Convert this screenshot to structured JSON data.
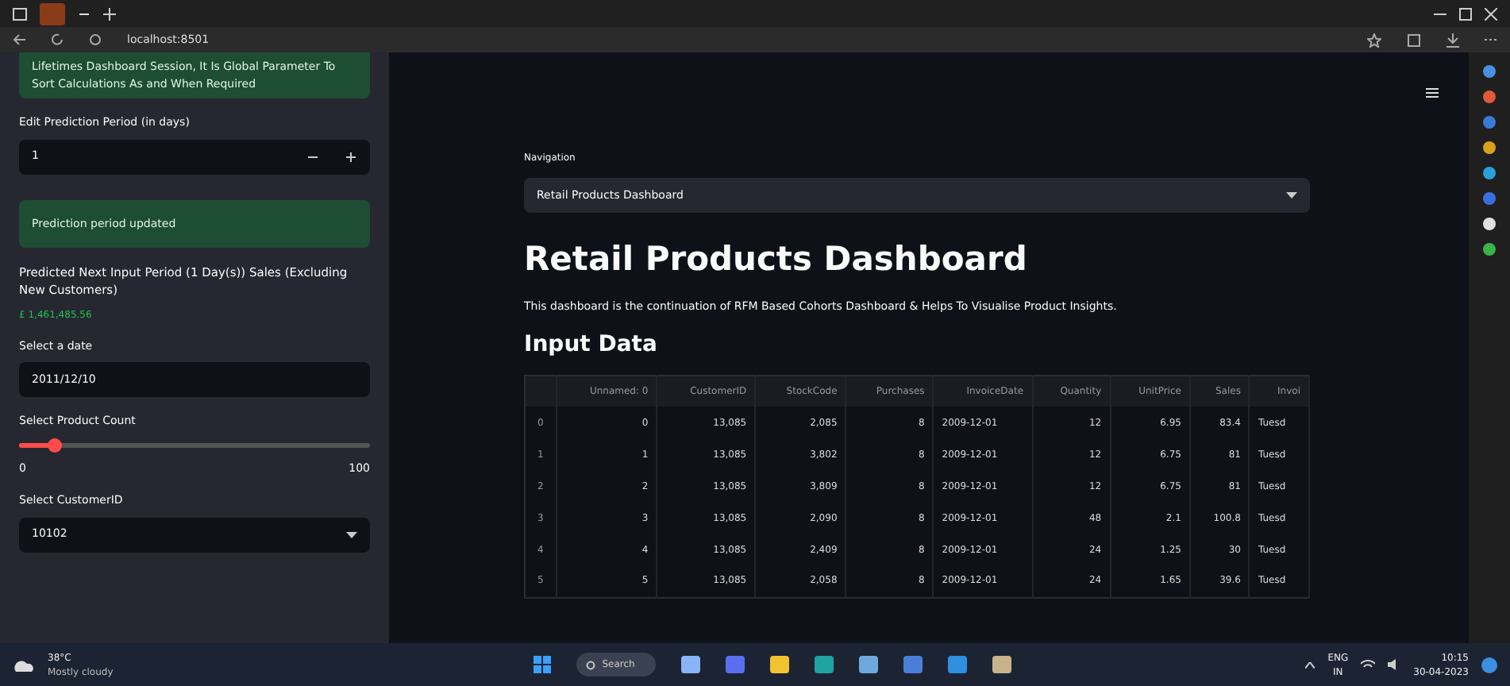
{
  "browser": {
    "url": "localhost:8501"
  },
  "sidebar": {
    "info": "Lifetimes Dashboard Session, It Is Global Parameter To Sort Calculations As and When Required",
    "prediction": {
      "label": "Edit Prediction Period (in days)",
      "value": "1"
    },
    "success": "Prediction period updated",
    "predicted": {
      "label": "Predicted Next Input Period (1 Day(s)) Sales (Excluding New Customers)",
      "value": "£ 1,461,485.56"
    },
    "date": {
      "label": "Select a date",
      "value": "2011/12/10"
    },
    "slider": {
      "label": "Select Product Count",
      "level": 0.1,
      "min": "0",
      "max": "100"
    },
    "customer": {
      "label": "Select CustomerID",
      "value": "10102"
    }
  },
  "main": {
    "nav_label": "Navigation",
    "nav_value": "Retail Products Dashboard",
    "title": "Retail Products Dashboard",
    "description": "This dashboard is the continuation of RFM Based Cohorts Dashboard & Helps To Visualise Product Insights.",
    "section": "Input Data",
    "table": {
      "columns": [
        "",
        "Unnamed: 0",
        "CustomerID",
        "StockCode",
        "Purchases",
        "InvoiceDate",
        "Quantity",
        "UnitPrice",
        "Sales",
        "Invoi"
      ],
      "rows": [
        [
          "0",
          "0",
          "13,085",
          "2,085",
          "8",
          "2009-12-01",
          "12",
          "6.95",
          "83.4",
          "Tuesd"
        ],
        [
          "1",
          "1",
          "13,085",
          "3,802",
          "8",
          "2009-12-01",
          "12",
          "6.75",
          "81",
          "Tuesd"
        ],
        [
          "2",
          "2",
          "13,085",
          "3,809",
          "8",
          "2009-12-01",
          "12",
          "6.75",
          "81",
          "Tuesd"
        ],
        [
          "3",
          "3",
          "13,085",
          "2,090",
          "8",
          "2009-12-01",
          "48",
          "2.1",
          "100.8",
          "Tuesd"
        ],
        [
          "4",
          "4",
          "13,085",
          "2,409",
          "8",
          "2009-12-01",
          "24",
          "1.25",
          "30",
          "Tuesd"
        ],
        [
          "5",
          "5",
          "13,085",
          "2,058",
          "8",
          "2009-12-01",
          "24",
          "1.65",
          "39.6",
          "Tuesd"
        ]
      ]
    }
  },
  "taskbar": {
    "temp": "38°C",
    "weather": "Mostly cloudy",
    "search": "Search",
    "lang": "ENG",
    "region": "IN",
    "time": "10:15",
    "date": "30-04-2023"
  }
}
